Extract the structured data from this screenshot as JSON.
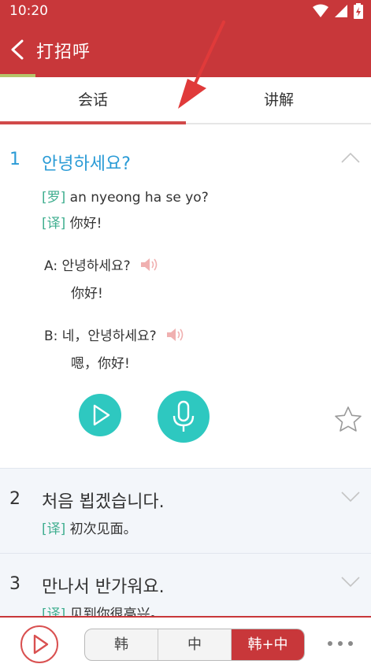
{
  "status": {
    "time": "10:20"
  },
  "header": {
    "title": "打招呼"
  },
  "tabs": [
    {
      "label": "会话",
      "active": true
    },
    {
      "label": "讲解",
      "active": false
    }
  ],
  "items": [
    {
      "num": "1",
      "korean": "안녕하세요?",
      "rom_tag": "[罗]",
      "romanization": "an nyeong ha se yo?",
      "tr_tag": "[译]",
      "translation": "你好!",
      "dialog": [
        {
          "speaker": "A:",
          "korean": "안녕하세요?",
          "chinese": "你好!"
        },
        {
          "speaker": "B:",
          "korean": "네，안녕하세요?",
          "chinese": "嗯，你好!"
        }
      ]
    },
    {
      "num": "2",
      "korean": "처음 뵙겠습니다.",
      "tr_tag": "[译]",
      "translation": "初次见面。"
    },
    {
      "num": "3",
      "korean": "만나서 반가워요.",
      "tr_tag": "[译]",
      "translation": "见到你很高兴。"
    }
  ],
  "bottom": {
    "segments": [
      {
        "label": "韩",
        "active": false
      },
      {
        "label": "中",
        "active": false
      },
      {
        "label": "韩+中",
        "active": true
      }
    ]
  },
  "colors": {
    "brand": "#c8373a",
    "accent_teal": "#2ec8c0",
    "link_blue": "#2a9bd6",
    "tag_green": "#3fae8f"
  },
  "icons": [
    "wifi-icon",
    "signal-icon",
    "battery-icon",
    "back-arrow-icon",
    "chevron-up-icon",
    "speaker-icon",
    "play-icon",
    "microphone-icon",
    "star-icon",
    "chevron-down-icon",
    "more-icon"
  ]
}
